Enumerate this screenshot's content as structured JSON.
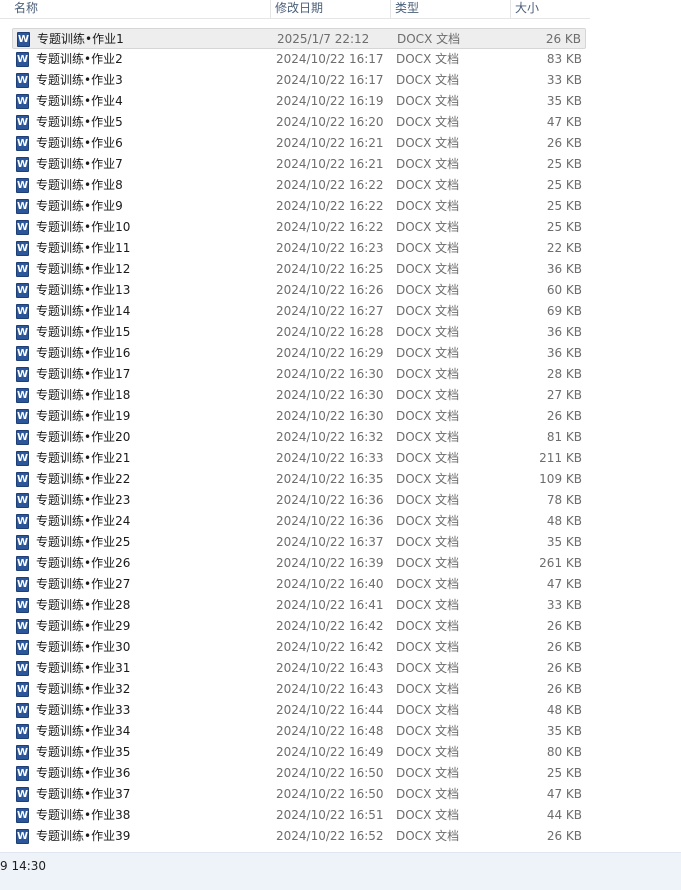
{
  "header": {
    "name": "名称",
    "date": "修改日期",
    "type": "类型",
    "size": "大小"
  },
  "file_icon": "word-doc-icon",
  "icon_letter": "W",
  "files": [
    {
      "name": "专题训练•作业1",
      "date": "2025/1/7 22:12",
      "type": "DOCX 文档",
      "size": "26 KB",
      "selected": true
    },
    {
      "name": "专题训练•作业2",
      "date": "2024/10/22 16:17",
      "type": "DOCX 文档",
      "size": "83 KB"
    },
    {
      "name": "专题训练•作业3",
      "date": "2024/10/22 16:17",
      "type": "DOCX 文档",
      "size": "33 KB"
    },
    {
      "name": "专题训练•作业4",
      "date": "2024/10/22 16:19",
      "type": "DOCX 文档",
      "size": "35 KB"
    },
    {
      "name": "专题训练•作业5",
      "date": "2024/10/22 16:20",
      "type": "DOCX 文档",
      "size": "47 KB"
    },
    {
      "name": "专题训练•作业6",
      "date": "2024/10/22 16:21",
      "type": "DOCX 文档",
      "size": "26 KB"
    },
    {
      "name": "专题训练•作业7",
      "date": "2024/10/22 16:21",
      "type": "DOCX 文档",
      "size": "25 KB"
    },
    {
      "name": "专题训练•作业8",
      "date": "2024/10/22 16:22",
      "type": "DOCX 文档",
      "size": "25 KB"
    },
    {
      "name": "专题训练•作业9",
      "date": "2024/10/22 16:22",
      "type": "DOCX 文档",
      "size": "25 KB"
    },
    {
      "name": "专题训练•作业10",
      "date": "2024/10/22 16:22",
      "type": "DOCX 文档",
      "size": "25 KB"
    },
    {
      "name": "专题训练•作业11",
      "date": "2024/10/22 16:23",
      "type": "DOCX 文档",
      "size": "22 KB"
    },
    {
      "name": "专题训练•作业12",
      "date": "2024/10/22 16:25",
      "type": "DOCX 文档",
      "size": "36 KB"
    },
    {
      "name": "专题训练•作业13",
      "date": "2024/10/22 16:26",
      "type": "DOCX 文档",
      "size": "60 KB"
    },
    {
      "name": "专题训练•作业14",
      "date": "2024/10/22 16:27",
      "type": "DOCX 文档",
      "size": "69 KB"
    },
    {
      "name": "专题训练•作业15",
      "date": "2024/10/22 16:28",
      "type": "DOCX 文档",
      "size": "36 KB"
    },
    {
      "name": "专题训练•作业16",
      "date": "2024/10/22 16:29",
      "type": "DOCX 文档",
      "size": "36 KB"
    },
    {
      "name": "专题训练•作业17",
      "date": "2024/10/22 16:30",
      "type": "DOCX 文档",
      "size": "28 KB"
    },
    {
      "name": "专题训练•作业18",
      "date": "2024/10/22 16:30",
      "type": "DOCX 文档",
      "size": "27 KB"
    },
    {
      "name": "专题训练•作业19",
      "date": "2024/10/22 16:30",
      "type": "DOCX 文档",
      "size": "26 KB"
    },
    {
      "name": "专题训练•作业20",
      "date": "2024/10/22 16:32",
      "type": "DOCX 文档",
      "size": "81 KB"
    },
    {
      "name": "专题训练•作业21",
      "date": "2024/10/22 16:33",
      "type": "DOCX 文档",
      "size": "211 KB"
    },
    {
      "name": "专题训练•作业22",
      "date": "2024/10/22 16:35",
      "type": "DOCX 文档",
      "size": "109 KB"
    },
    {
      "name": "专题训练•作业23",
      "date": "2024/10/22 16:36",
      "type": "DOCX 文档",
      "size": "78 KB"
    },
    {
      "name": "专题训练•作业24",
      "date": "2024/10/22 16:36",
      "type": "DOCX 文档",
      "size": "48 KB"
    },
    {
      "name": "专题训练•作业25",
      "date": "2024/10/22 16:37",
      "type": "DOCX 文档",
      "size": "35 KB"
    },
    {
      "name": "专题训练•作业26",
      "date": "2024/10/22 16:39",
      "type": "DOCX 文档",
      "size": "261 KB"
    },
    {
      "name": "专题训练•作业27",
      "date": "2024/10/22 16:40",
      "type": "DOCX 文档",
      "size": "47 KB"
    },
    {
      "name": "专题训练•作业28",
      "date": "2024/10/22 16:41",
      "type": "DOCX 文档",
      "size": "33 KB"
    },
    {
      "name": "专题训练•作业29",
      "date": "2024/10/22 16:42",
      "type": "DOCX 文档",
      "size": "26 KB"
    },
    {
      "name": "专题训练•作业30",
      "date": "2024/10/22 16:42",
      "type": "DOCX 文档",
      "size": "26 KB"
    },
    {
      "name": "专题训练•作业31",
      "date": "2024/10/22 16:43",
      "type": "DOCX 文档",
      "size": "26 KB"
    },
    {
      "name": "专题训练•作业32",
      "date": "2024/10/22 16:43",
      "type": "DOCX 文档",
      "size": "26 KB"
    },
    {
      "name": "专题训练•作业33",
      "date": "2024/10/22 16:44",
      "type": "DOCX 文档",
      "size": "48 KB"
    },
    {
      "name": "专题训练•作业34",
      "date": "2024/10/22 16:48",
      "type": "DOCX 文档",
      "size": "35 KB"
    },
    {
      "name": "专题训练•作业35",
      "date": "2024/10/22 16:49",
      "type": "DOCX 文档",
      "size": "80 KB"
    },
    {
      "name": "专题训练•作业36",
      "date": "2024/10/22 16:50",
      "type": "DOCX 文档",
      "size": "25 KB"
    },
    {
      "name": "专题训练•作业37",
      "date": "2024/10/22 16:50",
      "type": "DOCX 文档",
      "size": "47 KB"
    },
    {
      "name": "专题训练•作业38",
      "date": "2024/10/22 16:51",
      "type": "DOCX 文档",
      "size": "44 KB"
    },
    {
      "name": "专题训练•作业39",
      "date": "2024/10/22 16:52",
      "type": "DOCX 文档",
      "size": "26 KB"
    }
  ],
  "status_bar": {
    "text": "9 14:30"
  }
}
